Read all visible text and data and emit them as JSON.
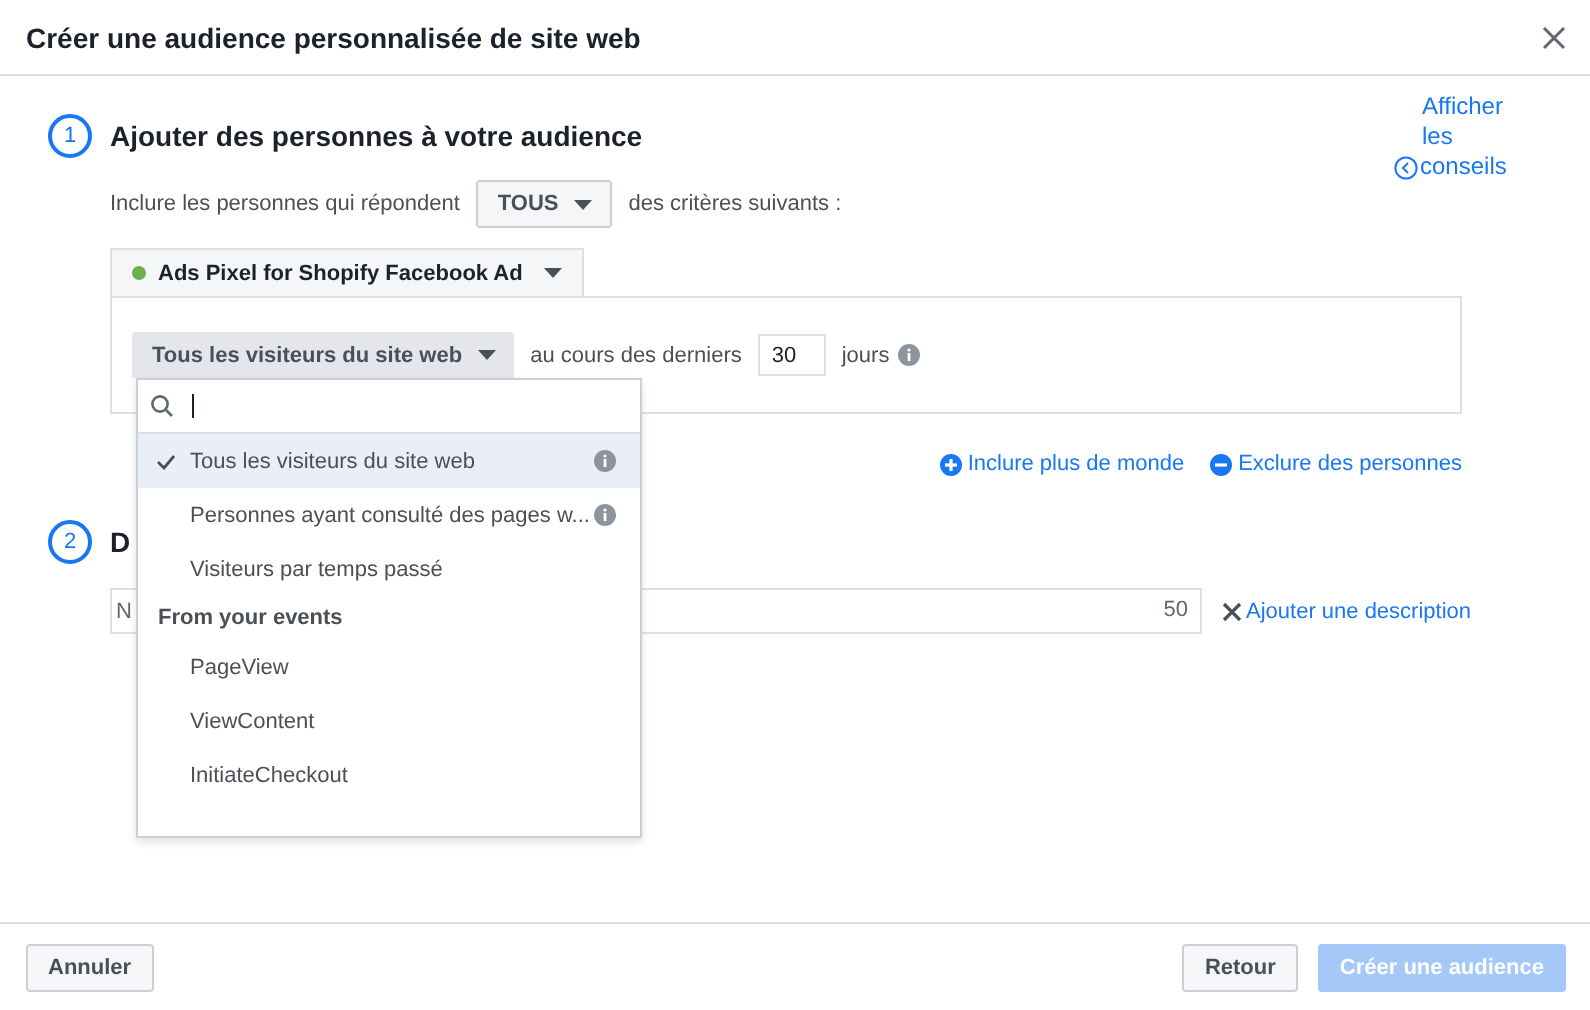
{
  "dialog": {
    "title": "Créer une audience personnalisée de site web"
  },
  "tips_link": {
    "words": [
      "Afficher",
      "les",
      "conseils"
    ]
  },
  "step1": {
    "number": "1",
    "title": "Ajouter des personnes à votre audience",
    "include_prefix": "Inclure les personnes qui répondent",
    "match_select": "TOUS",
    "include_suffix": "des critères suivants :"
  },
  "pixel": {
    "name": "Ads Pixel for Shopify Facebook Ad",
    "active": true
  },
  "rule": {
    "event_select": "Tous les visiteurs du site web",
    "period_prefix": "au cours des derniers",
    "days": "30",
    "period_suffix": "jours"
  },
  "dropdown": {
    "items": [
      {
        "kind": "option",
        "label": "Tous les visiteurs du site web",
        "selected": true,
        "info": true
      },
      {
        "kind": "option",
        "label": "Personnes ayant consulté des pages w...",
        "selected": false,
        "info": true
      },
      {
        "kind": "option",
        "label": "Visiteurs par temps passé",
        "selected": false,
        "info": false
      },
      {
        "kind": "header",
        "label": "From your events"
      },
      {
        "kind": "option",
        "label": "PageView",
        "selected": false,
        "info": false
      },
      {
        "kind": "option",
        "label": "ViewContent",
        "selected": false,
        "info": false
      },
      {
        "kind": "option",
        "label": "InitiateCheckout",
        "selected": false,
        "info": false
      }
    ]
  },
  "links": [
    {
      "kind": "include",
      "label": "Inclure plus de monde"
    },
    {
      "kind": "exclude",
      "label": "Exclure des personnes"
    }
  ],
  "step2": {
    "number": "2",
    "title": "D",
    "name_placeholder": "N",
    "char_count": "50",
    "description_link": "Ajouter une description"
  },
  "footer": {
    "cancel": "Annuler",
    "back": "Retour",
    "create": {
      "label": "Créer une audience",
      "disabled": true
    }
  }
}
